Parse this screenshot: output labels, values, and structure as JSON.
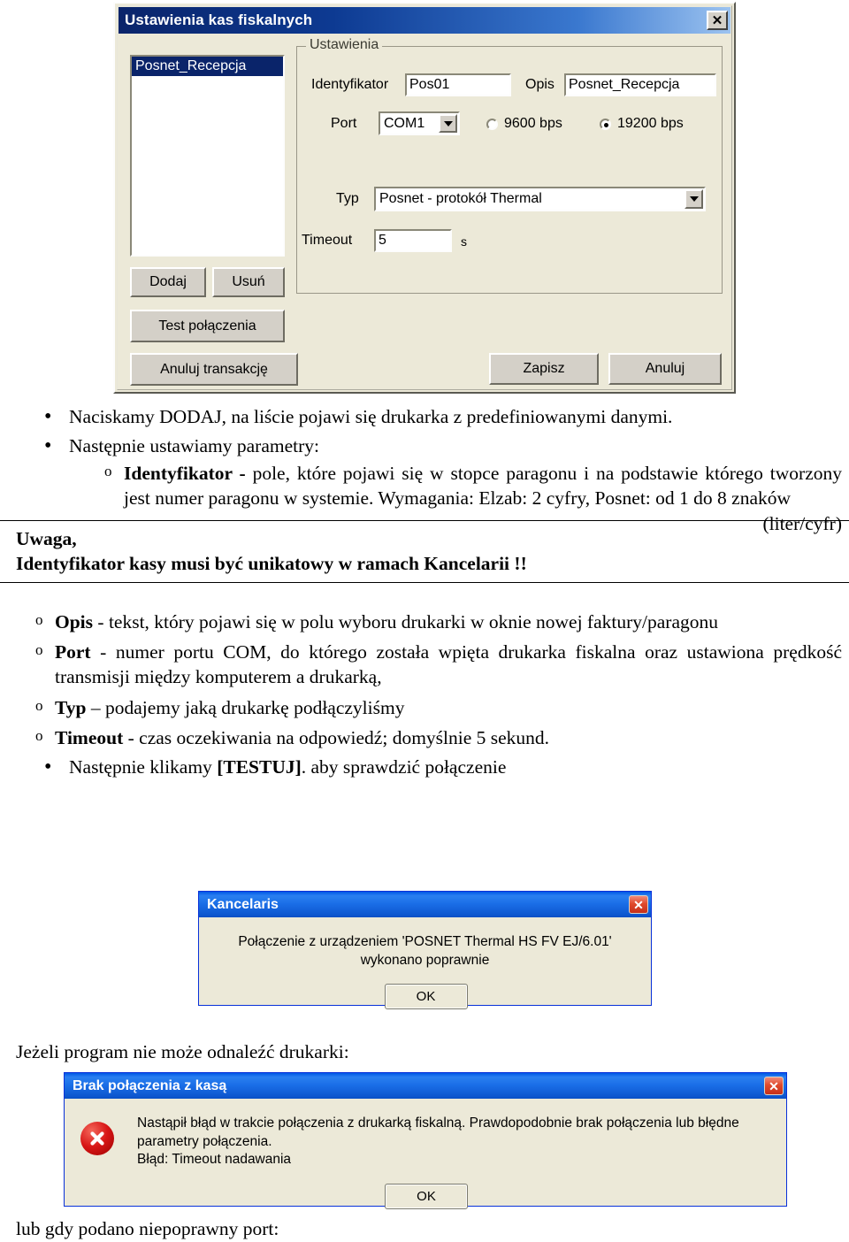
{
  "settings_dialog": {
    "title": "Ustawienia kas fiskalnych",
    "close_label": "✕",
    "list": {
      "items": [
        "Posnet_Recepcja"
      ]
    },
    "groupbox_title": "Ustawienia",
    "fields": {
      "identifier_label": "Identyfikator",
      "identifier_value": "Pos01",
      "description_label": "Opis",
      "description_value": "Posnet_Recepcja",
      "port_label": "Port",
      "port_value": "COM1",
      "speed_options": [
        {
          "label": "9600 bps",
          "selected": false
        },
        {
          "label": "19200 bps",
          "selected": true
        }
      ],
      "type_label": "Typ",
      "type_value": "Posnet - protokół Thermal",
      "timeout_label": "Timeout",
      "timeout_value": "5",
      "timeout_unit": "s"
    },
    "buttons": {
      "add": "Dodaj",
      "delete": "Usuń",
      "test_connection": "Test połączenia",
      "cancel_transaction": "Anuluj transakcję",
      "save": "Zapisz",
      "cancel": "Anuluj"
    },
    "colors": {
      "titlebar_start": "#0a246a",
      "titlebar_end": "#9cc3f0",
      "face": "#ece9d8",
      "selection": "#0a246a"
    }
  },
  "document": {
    "bullet1": "Naciskamy DODAJ, na liście pojawi się drukarka z predefiniowanymi danymi.",
    "bullet2": "Następnie ustawiamy parametry:",
    "sub_identifier_bold": "Identyfikator - ",
    "sub_identifier_text": "pole, które pojawi się w stopce paragonu i na podstawie którego tworzony jest numer paragonu w systemie. Wymagania: Elzab: 2 cyfry, Posnet: od 1 do 8 znaków",
    "sub_identifier_right": "(liter/cyfr)",
    "note_line1": "Uwaga,",
    "note_line2": "Identyfikator kasy musi być unikatowy w ramach Kancelarii !!",
    "sub_opis_bold": "Opis ",
    "sub_opis_text": "- tekst, który pojawi się w polu wyboru drukarki w oknie nowej faktury/paragonu",
    "sub_port_bold": "Port ",
    "sub_port_text": "- numer portu COM, do którego została wpięta drukarka fiskalna oraz ustawiona prędkość transmisji między komputerem a drukarką,",
    "sub_typ_bold": "Typ ",
    "sub_typ_text": "– podajemy jaką drukarkę podłączyliśmy",
    "sub_timeout_bold": "Timeout ",
    "sub_timeout_text": "- czas oczekiwania na odpowiedź; domyślnie 5 sekund.",
    "bullet3_pre": "Następnie klikamy ",
    "bullet3_bold": "[TESTUJ]",
    "bullet3_post": ". aby sprawdzić połączenie",
    "line_not_found": "Jeżeli program nie może odnaleźć drukarki:",
    "line_wrong_port": "lub gdy podano niepoprawny port:"
  },
  "success_dialog": {
    "title": "Kancelaris",
    "close_label": "✕",
    "message": "Połączenie z urządzeniem 'POSNET Thermal HS FV EJ/6.01' wykonano poprawnie",
    "ok_label": "OK",
    "colors": {
      "titlebar": "#0058e6",
      "close": "#d8402a"
    }
  },
  "error_dialog": {
    "title": "Brak połączenia z kasą",
    "close_label": "✕",
    "message_line1": "Nastąpił błąd w trakcie połączenia z drukarką fiskalną. Prawdopodobnie brak połączenia lub błędne parametry połączenia.",
    "message_line2": "Błąd: Timeout nadawania",
    "ok_label": "OK",
    "icon": "error-circle-icon",
    "colors": {
      "titlebar": "#0058e6",
      "icon": "#d81616"
    }
  }
}
